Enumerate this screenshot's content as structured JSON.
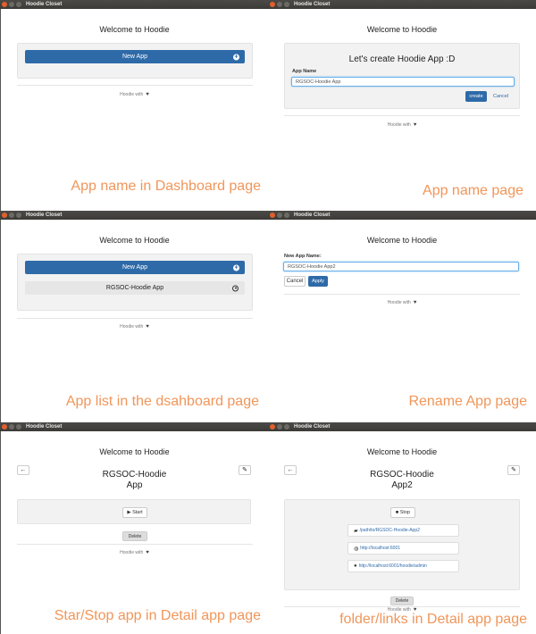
{
  "window_title": "Hoodie Closet",
  "welcome": "Welcome to Hoodie",
  "footer_text": "Hoodie with",
  "heart": "♥",
  "panel1": {
    "new_app": "New App",
    "caption": "App name in Dashboard page"
  },
  "panel2": {
    "heading": "Let's create Hoodie App :D",
    "label": "App Name",
    "input_value": "RGSOC-Hoodie App",
    "create": "create",
    "cancel": "Cancel",
    "caption": "App name page"
  },
  "panel3": {
    "new_app": "New App",
    "app_item": "RGSOC-Hoodie App",
    "caption": "App list in the dsahboard page"
  },
  "panel4": {
    "label": "New App Name:",
    "input_value": "RGSOC-Hoodie App2",
    "cancel": "Cancel",
    "apply": "Apply",
    "caption": "Rename App page"
  },
  "panel5": {
    "title_line1": "RGSOC-Hoodie",
    "title_line2": "App",
    "start": "▶ Start",
    "delete": "Delete",
    "caption": "Star/Stop app in Detail app page"
  },
  "panel6": {
    "title_line1": "RGSOC-Hoodie",
    "title_line2": "App2",
    "stop": "■ Stop",
    "folder_path": "/path/to/RGSOC-Hoodie-App2",
    "link1": "http://localhost:6001",
    "link2": "http://localhost:6001/hoodie/admin",
    "delete": "Delete",
    "caption": "folder/links in Detail app page"
  },
  "icons": {
    "back": "←",
    "edit": "✎",
    "plus": "+",
    "folder": "▰",
    "globe": "◍",
    "user": "●"
  }
}
